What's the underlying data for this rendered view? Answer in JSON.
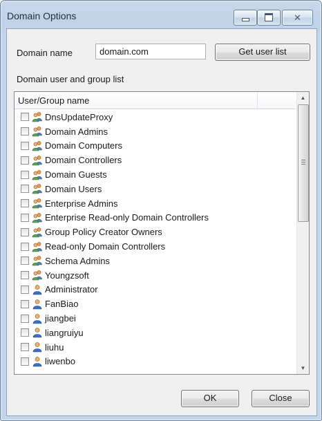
{
  "window": {
    "title": "Domain Options",
    "close_glyph": "✕"
  },
  "form": {
    "domain_label": "Domain name",
    "domain_value": "domain.com",
    "get_user_list_label": "Get user list",
    "list_label": "Domain user and group list"
  },
  "list": {
    "column_header": "User/Group name",
    "items": [
      {
        "name": "DnsUpdateProxy",
        "type": "group",
        "icon": "group-icon"
      },
      {
        "name": "Domain Admins",
        "type": "group",
        "icon": "group-icon"
      },
      {
        "name": "Domain Computers",
        "type": "group",
        "icon": "group-icon"
      },
      {
        "name": "Domain Controllers",
        "type": "group",
        "icon": "group-icon"
      },
      {
        "name": "Domain Guests",
        "type": "group",
        "icon": "group-icon"
      },
      {
        "name": "Domain Users",
        "type": "group",
        "icon": "group-icon"
      },
      {
        "name": "Enterprise Admins",
        "type": "group",
        "icon": "group-icon"
      },
      {
        "name": "Enterprise Read-only Domain Controllers",
        "type": "group",
        "icon": "group-icon"
      },
      {
        "name": "Group Policy Creator Owners",
        "type": "group",
        "icon": "group-icon"
      },
      {
        "name": "Read-only Domain Controllers",
        "type": "group",
        "icon": "group-icon"
      },
      {
        "name": "Schema Admins",
        "type": "group",
        "icon": "group-icon"
      },
      {
        "name": "Youngzsoft",
        "type": "group",
        "icon": "group-icon"
      },
      {
        "name": "Administrator",
        "type": "user",
        "icon": "user-icon"
      },
      {
        "name": "FanBiao",
        "type": "user",
        "icon": "user-icon"
      },
      {
        "name": "jiangbei",
        "type": "user",
        "icon": "user-icon"
      },
      {
        "name": "liangruiyu",
        "type": "user",
        "icon": "user-icon"
      },
      {
        "name": "liuhu",
        "type": "user",
        "icon": "user-icon"
      },
      {
        "name": "liwenbo",
        "type": "user",
        "icon": "user-icon"
      }
    ]
  },
  "buttons": {
    "ok": "OK",
    "close": "Close"
  },
  "colors": {
    "title_bar": "#c3d5ea",
    "client_bg": "#f0f0f0",
    "list_bg": "#ffffff"
  }
}
